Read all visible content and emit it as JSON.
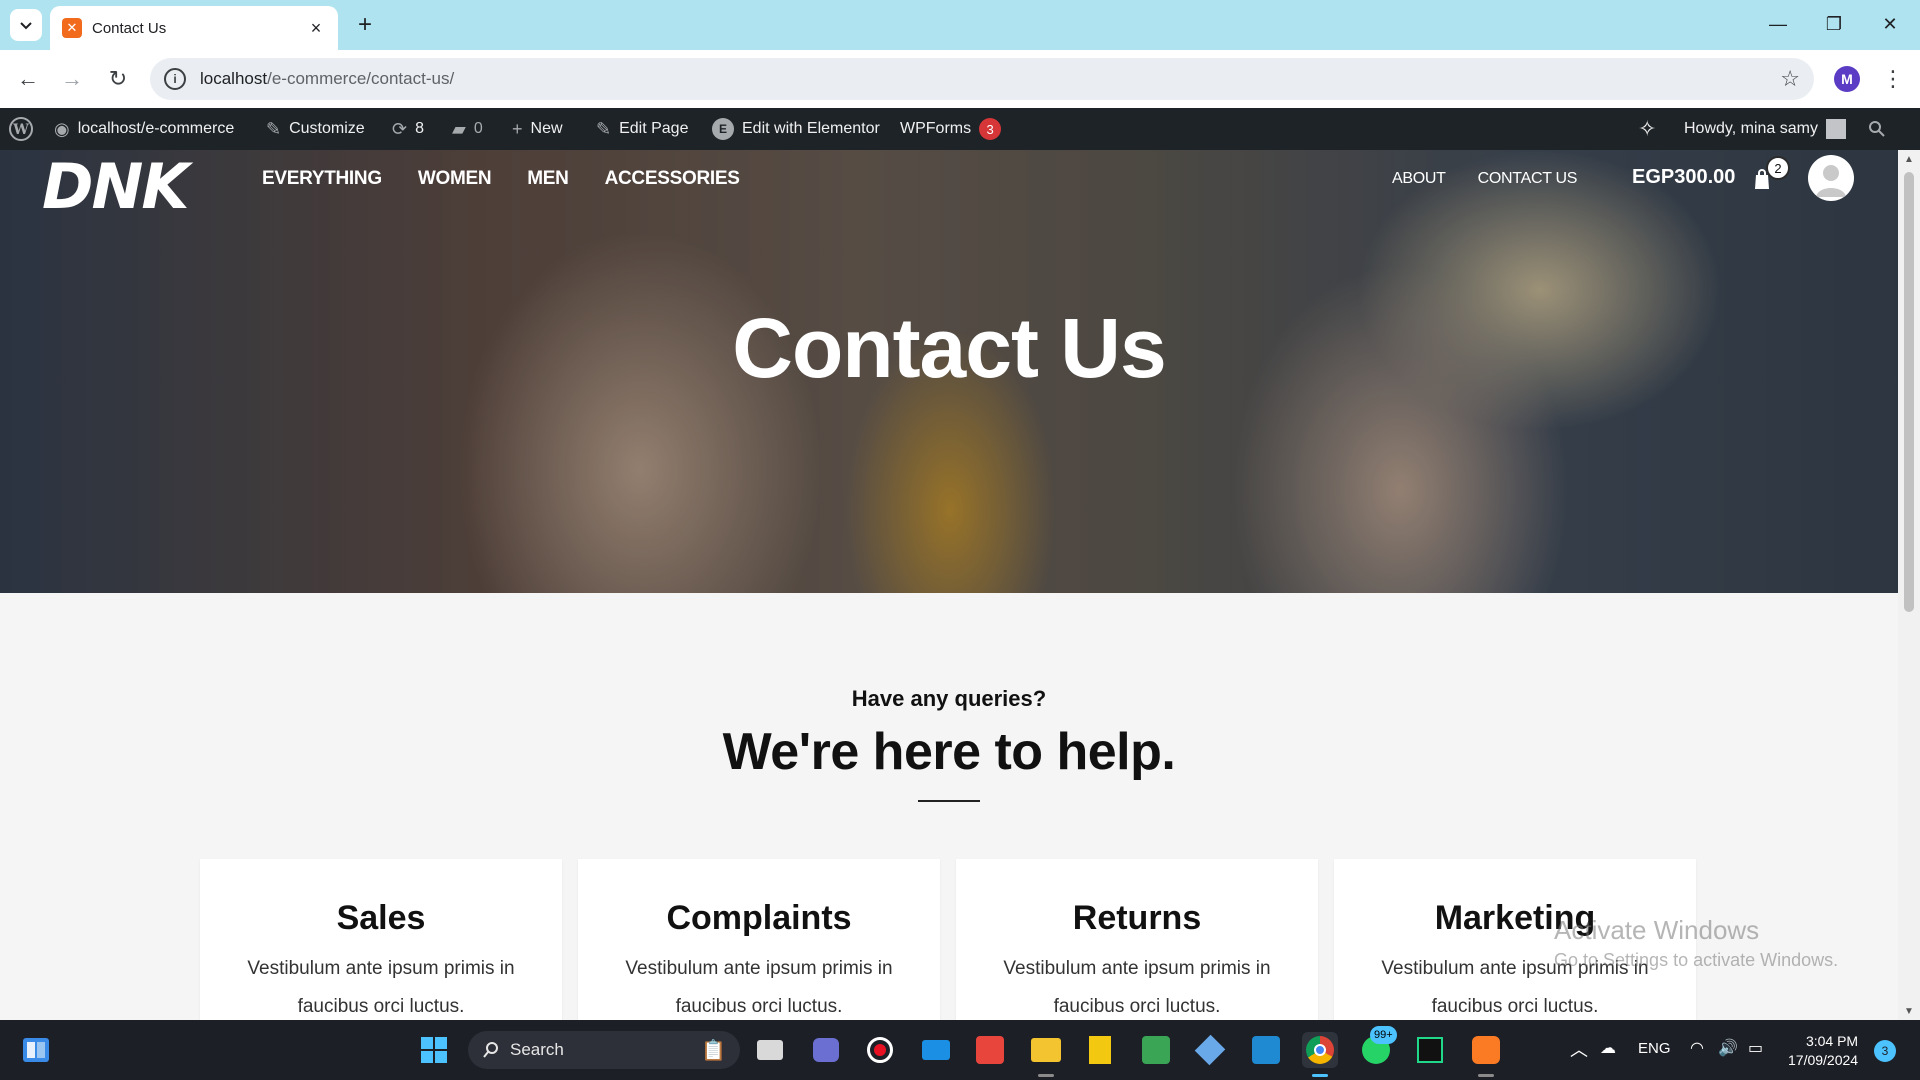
{
  "browser": {
    "tab_title": "Contact Us",
    "url_host": "localhost",
    "url_path": "/e-commerce/contact-us/",
    "profile_initial": "M"
  },
  "adminbar": {
    "site_name": "localhost/e-commerce",
    "customize": "Customize",
    "updates_count": "8",
    "comments_count": "0",
    "new": "New",
    "edit_page": "Edit Page",
    "edit_elementor": "Edit with Elementor",
    "wpforms": "WPForms",
    "wpforms_count": "3",
    "howdy": "Howdy, mina samy"
  },
  "site": {
    "logo": "DNK",
    "nav_left": [
      "EVERYTHING",
      "WOMEN",
      "MEN",
      "ACCESSORIES"
    ],
    "nav_right": [
      "ABOUT",
      "CONTACT US"
    ],
    "cart_total": "EGP300.00",
    "cart_count": "2"
  },
  "hero": {
    "title": "Contact Us"
  },
  "intro": {
    "subtitle": "Have any queries?",
    "title": "We're here to help."
  },
  "cards": [
    {
      "title": "Sales",
      "line1": "Vestibulum ante ipsum primis in",
      "line2": "faucibus orci luctus."
    },
    {
      "title": "Complaints",
      "line1": "Vestibulum ante ipsum primis in",
      "line2": "faucibus orci luctus."
    },
    {
      "title": "Returns",
      "line1": "Vestibulum ante ipsum primis in",
      "line2": "faucibus orci luctus."
    },
    {
      "title": "Marketing",
      "line1": "Vestibulum ante ipsum primis in",
      "line2": "faucibus orci luctus."
    }
  ],
  "watermark": {
    "line1": "Activate Windows",
    "line2": "Go to Settings to activate Windows."
  },
  "taskbar": {
    "search_label": "Search",
    "whatsapp_badge": "99+",
    "language": "ENG",
    "time": "3:04 PM",
    "date": "17/09/2024",
    "notification_count": "3"
  },
  "colors": {
    "tabstrip": "#aee3ef",
    "adminbar": "#1d2327",
    "wp_badge": "#d63638",
    "taskbar": "#1c1f26",
    "page_bg": "#f5f5f5"
  }
}
